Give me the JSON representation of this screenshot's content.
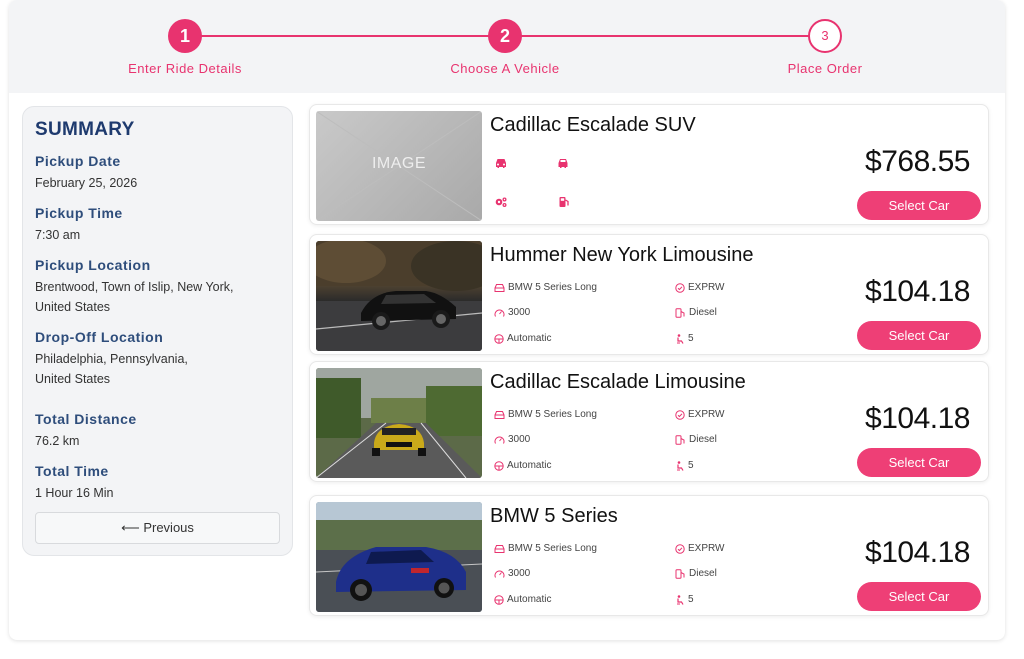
{
  "stepper": {
    "steps": [
      {
        "number": "1",
        "label": "Enter Ride Details",
        "state": "complete"
      },
      {
        "number": "2",
        "label": "Choose A Vehicle",
        "state": "active"
      },
      {
        "number": "3",
        "label": "Place Order",
        "state": "pending"
      }
    ]
  },
  "summary": {
    "title": "SUMMARY",
    "pickup_date_label": "Pickup Date",
    "pickup_date": "February 25, 2026",
    "pickup_time_label": "Pickup Time",
    "pickup_time": "7:30 am",
    "pickup_location_label": "Pickup Location",
    "pickup_location_line1": "Brentwood, Town of Islip, New York,",
    "pickup_location_line2": "United States",
    "dropoff_location_label": "Drop-Off Location",
    "dropoff_location_line1": "Philadelphia, Pennsylvania,",
    "dropoff_location_line2": "United States",
    "total_distance_label": "Total Distance",
    "total_distance": "76.2 km",
    "total_time_label": "Total Time",
    "total_time": "1 Hour 16 Min",
    "previous_label": "⟵ Previous"
  },
  "vehicles": [
    {
      "name": "Cadillac Escalade SUV",
      "price": "$768.55",
      "select_label": "Select Car",
      "image_placeholder": "IMAGE",
      "icons": [
        "car-front-icon",
        "car-icon",
        "gears-icon",
        "fuel-pump-icon"
      ]
    },
    {
      "name": "Hummer New York Limousine",
      "price": "$104.18",
      "select_label": "Select Car",
      "model": "BMW 5 Series Long",
      "plan": "EXPRW",
      "mileage": "3000",
      "fuel": "Diesel",
      "transmission": "Automatic",
      "seats": "5"
    },
    {
      "name": "Cadillac Escalade Limousine",
      "price": "$104.18",
      "select_label": "Select Car",
      "model": "BMW 5 Series Long",
      "plan": "EXPRW",
      "mileage": "3000",
      "fuel": "Diesel",
      "transmission": "Automatic",
      "seats": "5"
    },
    {
      "name": "BMW 5 Series",
      "price": "$104.18",
      "select_label": "Select Car",
      "model": "BMW 5 Series Long",
      "plan": "EXPRW",
      "mileage": "3000",
      "fuel": "Diesel",
      "transmission": "Automatic",
      "seats": "5"
    }
  ],
  "colors": {
    "accent": "#e8336f",
    "button": "#ee3f76",
    "summary_heading": "#1e3a6e"
  }
}
